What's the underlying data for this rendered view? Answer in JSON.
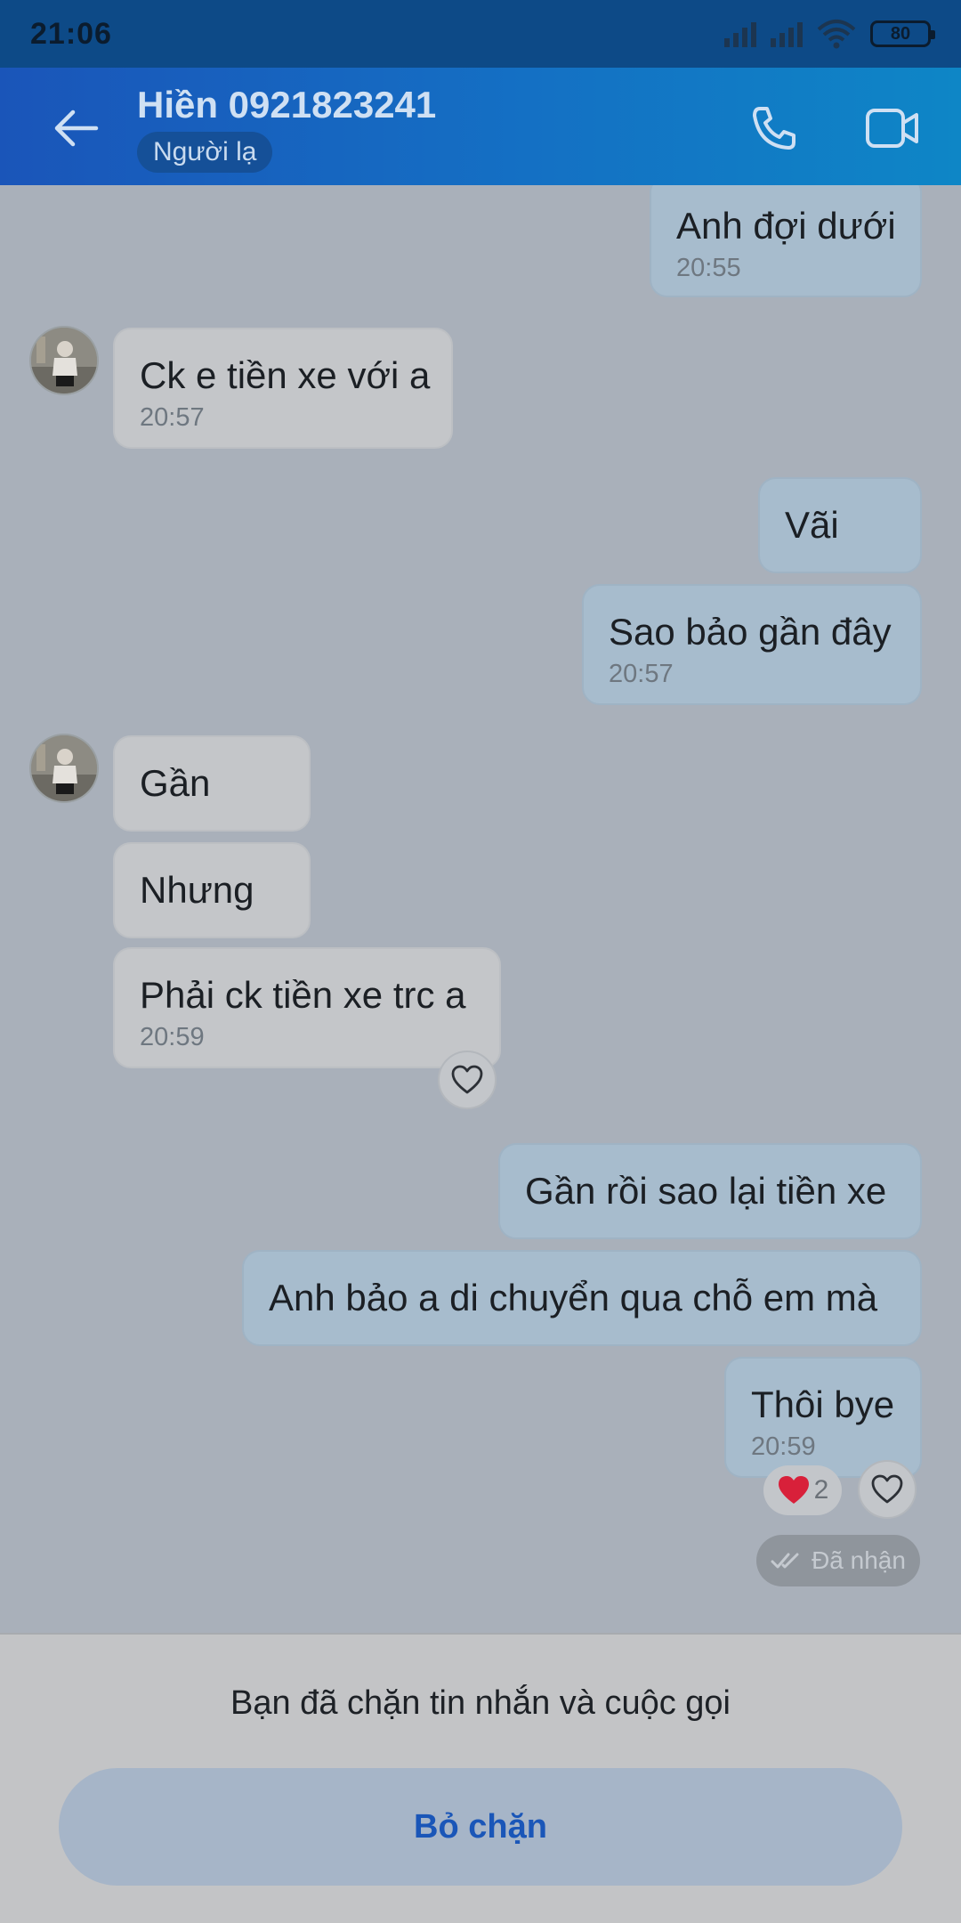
{
  "status_bar": {
    "time": "21:06",
    "battery": "80"
  },
  "header": {
    "contact_name": "Hiền 0921823241",
    "badge": "Người lạ"
  },
  "messages": [
    {
      "direction": "out",
      "text": "Anh đợi dưới",
      "time": "20:55"
    },
    {
      "direction": "in",
      "text": "Ck e tiền xe với a",
      "time": "20:57"
    },
    {
      "direction": "out",
      "text": "Vãi",
      "time": ""
    },
    {
      "direction": "out",
      "text": "Sao bảo gần đây",
      "time": "20:57"
    },
    {
      "direction": "in",
      "text": "Gần",
      "time": ""
    },
    {
      "direction": "in",
      "text": "Nhưng",
      "time": ""
    },
    {
      "direction": "in",
      "text": "Phải ck tiền xe trc a",
      "time": "20:59"
    },
    {
      "direction": "out",
      "text": "Gần rồi sao lại tiền xe",
      "time": ""
    },
    {
      "direction": "out",
      "text": "Anh bảo a di chuyển qua chỗ em mà",
      "time": ""
    },
    {
      "direction": "out",
      "text": "Thôi bye",
      "time": "20:59"
    }
  ],
  "reaction": {
    "icon": "heart-emoji",
    "count": "2",
    "color": "#d8203a"
  },
  "delivery_status": "Đã nhận",
  "bottom": {
    "blocked_text": "Bạn đã chặn tin nhắn và cuộc gọi",
    "unblock_label": "Bỏ chặn"
  }
}
